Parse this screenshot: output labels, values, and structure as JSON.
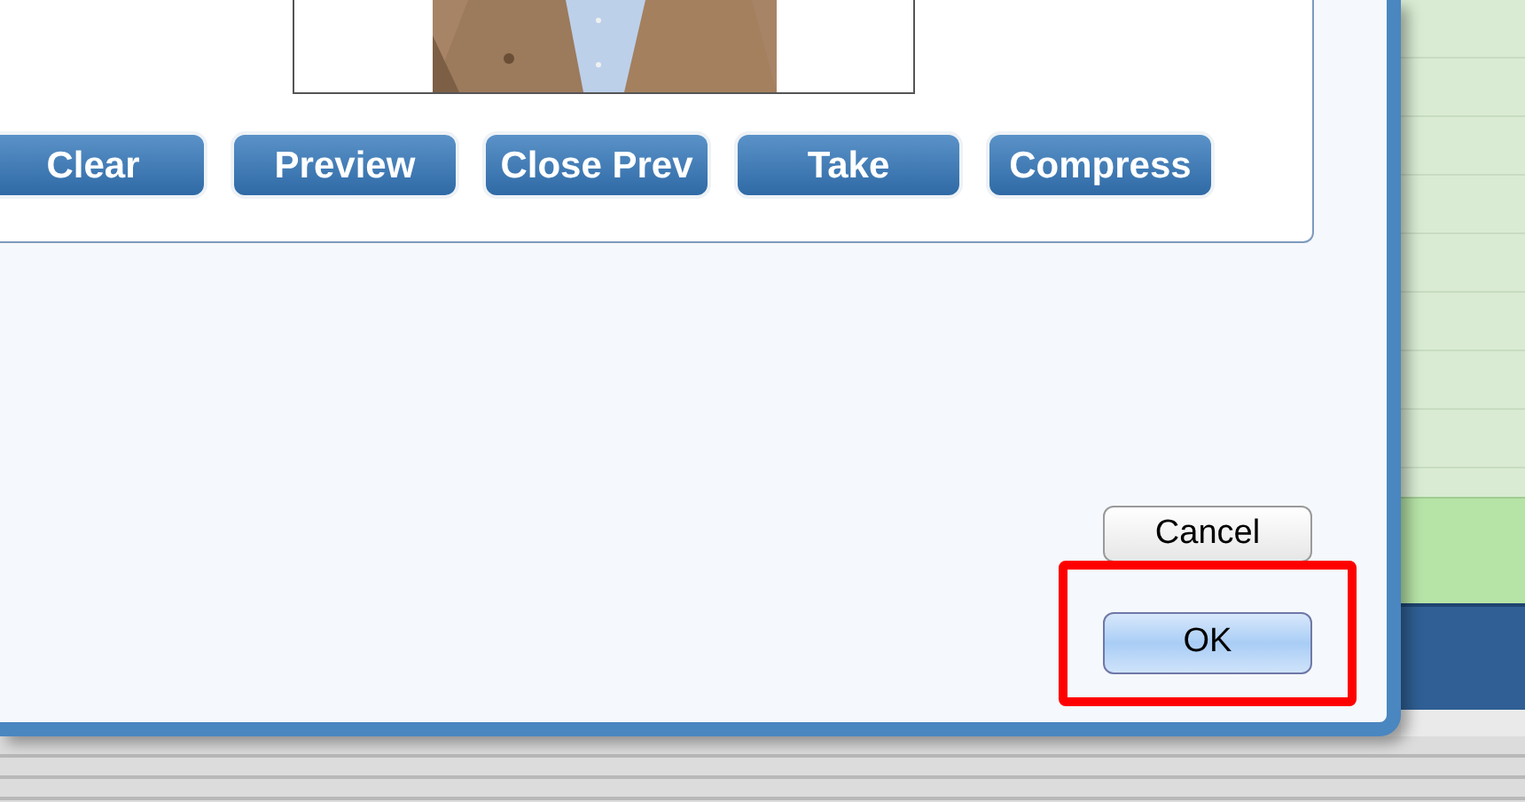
{
  "tool_buttons": [
    "Clear",
    "Preview",
    "Close Prev",
    "Take",
    "Compress"
  ],
  "dialog_buttons": [
    {
      "label": "Cancel",
      "default": false
    },
    {
      "label": "OK",
      "default": true
    }
  ]
}
